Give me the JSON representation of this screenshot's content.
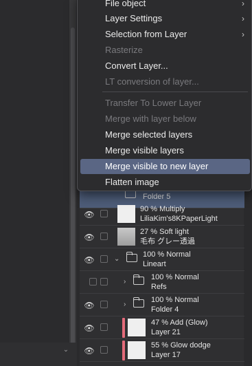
{
  "menu": {
    "items": [
      {
        "label": "File object",
        "disabled": false,
        "submenu": true
      },
      {
        "label": "Layer Settings",
        "disabled": false,
        "submenu": true
      },
      {
        "label": "Selection from Layer",
        "disabled": false,
        "submenu": true
      },
      {
        "label": "Rasterize",
        "disabled": true,
        "submenu": false
      },
      {
        "label": "Convert Layer...",
        "disabled": false,
        "submenu": false
      },
      {
        "label": "LT conversion of layer...",
        "disabled": true,
        "submenu": false
      },
      {
        "label": "Transfer To Lower Layer",
        "disabled": true,
        "submenu": false
      },
      {
        "label": "Merge with layer below",
        "disabled": true,
        "submenu": false
      },
      {
        "label": "Merge selected layers",
        "disabled": false,
        "submenu": false
      },
      {
        "label": "Merge visible layers",
        "disabled": false,
        "submenu": false
      },
      {
        "label": "Merge visible to new layer",
        "disabled": false,
        "submenu": false,
        "highlighted": true
      },
      {
        "label": "Flatten image",
        "disabled": false,
        "submenu": false
      }
    ]
  },
  "layers": [
    {
      "blend": "",
      "name": "Folder 5",
      "type": "folder",
      "selected": true
    },
    {
      "blend": "90 % Multiply",
      "name": "LiliaKim's8KPaperLight",
      "type": "raster"
    },
    {
      "blend": "27 % Soft light",
      "name": "毛布 グレー透過",
      "type": "raster"
    },
    {
      "blend": "100 % Normal",
      "name": "Lineart",
      "type": "folder",
      "expanded": true
    },
    {
      "blend": "100 % Normal",
      "name": "Refs",
      "type": "folder"
    },
    {
      "blend": "100 % Normal",
      "name": "Folder 4",
      "type": "folder"
    },
    {
      "blend": "47 % Add (Glow)",
      "name": "Layer 21",
      "type": "raster",
      "tagged": true
    },
    {
      "blend": "55 % Glow dodge",
      "name": "Layer 17",
      "type": "raster",
      "tagged": true
    }
  ],
  "colors": {
    "highlight": "#5a6684",
    "selected_row": "#4d5c78",
    "tag": "#e46b7a"
  }
}
